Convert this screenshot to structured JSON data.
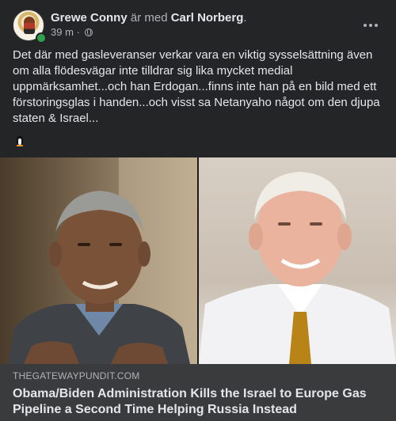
{
  "post": {
    "author": "Grewe Conny",
    "with_text": "är med",
    "tagged": "Carl Norberg",
    "period": ".",
    "time": "39 m",
    "dot": "·",
    "body": "Det där med gasleveranser verkar vara en viktig sysselsättning även om alla flödesvägar inte tilldrar sig lika mycket medial uppmärksamhet...och han Erdogan...finns inte han på en bild med ett förstoringsglas i handen...och visst sa Netanyaho något om den djupa staten & Israel...",
    "emoji": "penguin-emoji"
  },
  "link": {
    "domain": "THEGATEWAYPUNDIT.COM",
    "headline": "Obama/Biden Administration Kills the Israel to Europe Gas Pipeline a Second Time Helping Russia Instead"
  },
  "icons": {
    "audience": "globe-icon",
    "menu": "more-options-icon"
  },
  "colors": {
    "background": "#242526",
    "link_box": "#3a3b3c",
    "text": "#e4e6eb",
    "muted": "#b0b3b8",
    "online": "#31a24c"
  }
}
